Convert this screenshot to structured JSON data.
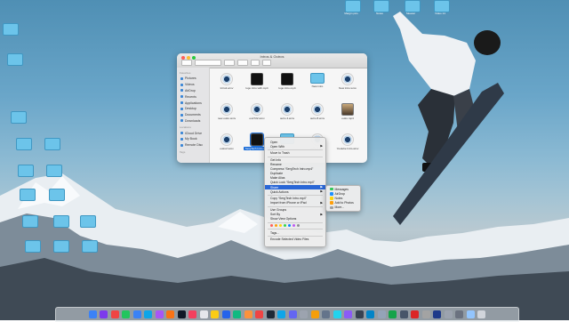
{
  "finder": {
    "title": "Intros & Outros",
    "sidebar": {
      "favorites_header": "Favorites",
      "favorites": [
        "Pictures",
        "Videos",
        "AirDrop",
        "Recents",
        "Applications",
        "Desktop",
        "Documents",
        "Downloads"
      ],
      "locations_header": "Locations",
      "locations": [
        "iCloud Drive",
        "My Book",
        "Remote Disc"
      ],
      "tags_header": "Tags"
    },
    "files": [
      {
        "name": "Intro2.wmv",
        "kind": "qt"
      },
      {
        "name": "logo intro with.mp4",
        "kind": "video"
      },
      {
        "name": "logo intro.mp4",
        "kind": "video"
      },
      {
        "name": "New intro",
        "kind": "folder"
      },
      {
        "name": "New intro.wmv",
        "kind": "qt"
      },
      {
        "name": "new outro.wmv",
        "kind": "qt"
      },
      {
        "name": "outr722.wmv",
        "kind": "qt"
      },
      {
        "name": "outro 4.wmv",
        "kind": "qt"
      },
      {
        "name": "outro 8.wmv",
        "kind": "qt"
      },
      {
        "name": "outro.mp4",
        "kind": "photo"
      },
      {
        "name": "outro2.wmv",
        "kind": "qt"
      },
      {
        "name": "SergTech Intro.mp4",
        "kind": "video",
        "selected": true
      },
      {
        "name": "",
        "kind": "folder"
      },
      {
        "name": "outro 2.wmv",
        "kind": "qt"
      },
      {
        "name": "Youtube Intro.wmv",
        "kind": "qt"
      }
    ]
  },
  "context_menu": {
    "groups": [
      [
        {
          "label": "Open"
        },
        {
          "label": "Open With",
          "submenu": true
        }
      ],
      [
        {
          "label": "Move to Trash"
        }
      ],
      [
        {
          "label": "Get Info"
        },
        {
          "label": "Rename"
        },
        {
          "label": "Compress “SergTech Intro.mp4”"
        },
        {
          "label": "Duplicate"
        },
        {
          "label": "Make Alias"
        },
        {
          "label": "Quick Look “SergTech Intro.mp4”"
        },
        {
          "label": "Share",
          "submenu": true,
          "highlighted": true
        },
        {
          "label": "Quick Actions",
          "submenu": true
        }
      ],
      [
        {
          "label": "Copy “SergTech Intro.mp4”"
        },
        {
          "label": "Import from iPhone or iPad",
          "submenu": true
        }
      ],
      [
        {
          "label": "Use Groups"
        },
        {
          "label": "Sort By",
          "submenu": true
        },
        {
          "label": "Show View Options"
        }
      ],
      [
        {
          "label": "Tags..."
        }
      ],
      [
        {
          "label": "Encode Selected Video Files"
        }
      ]
    ],
    "tag_colors": [
      "#ff5f57",
      "#ff9f0a",
      "#ffd60a",
      "#32d74b",
      "#0a84ff",
      "#bf5af2",
      "#8e8e93"
    ]
  },
  "share_submenu": [
    {
      "label": "Messages",
      "color": "#34c759"
    },
    {
      "label": "AirDrop",
      "color": "#1e90ff"
    },
    {
      "label": "Notes",
      "color": "#ffd60a"
    },
    {
      "label": "Add to Photos",
      "color": "#ff9f0a"
    },
    {
      "label": "More...",
      "color": "#a0a0a0"
    }
  ],
  "desktop_labels": [
    "Margin pics",
    "Notes",
    "Skeeter",
    "Video 14"
  ],
  "dock_colors": [
    "#3b82f6",
    "#7c3aed",
    "#ef4444",
    "#22c55e",
    "#3b82f6",
    "#0ea5e9",
    "#a855f7",
    "#f97316",
    "#111827",
    "#f43f5e",
    "#e5e7eb",
    "#facc15",
    "#2563eb",
    "#10b981",
    "#fb923c",
    "#ef4444",
    "#1f2937",
    "#0ea5e9",
    "#6366f1",
    "#9ca3af",
    "#f59e0b",
    "#64748b",
    "#22d3ee",
    "#8b5cf6",
    "#374151",
    "#0284c7",
    "#94a3b8",
    "#16a34a",
    "#475569",
    "#dc2626",
    "#a3a3a3",
    "#1e3a8a",
    "#9ca3af",
    "#6b7280",
    "#93c5fd",
    "#d1d5db"
  ]
}
